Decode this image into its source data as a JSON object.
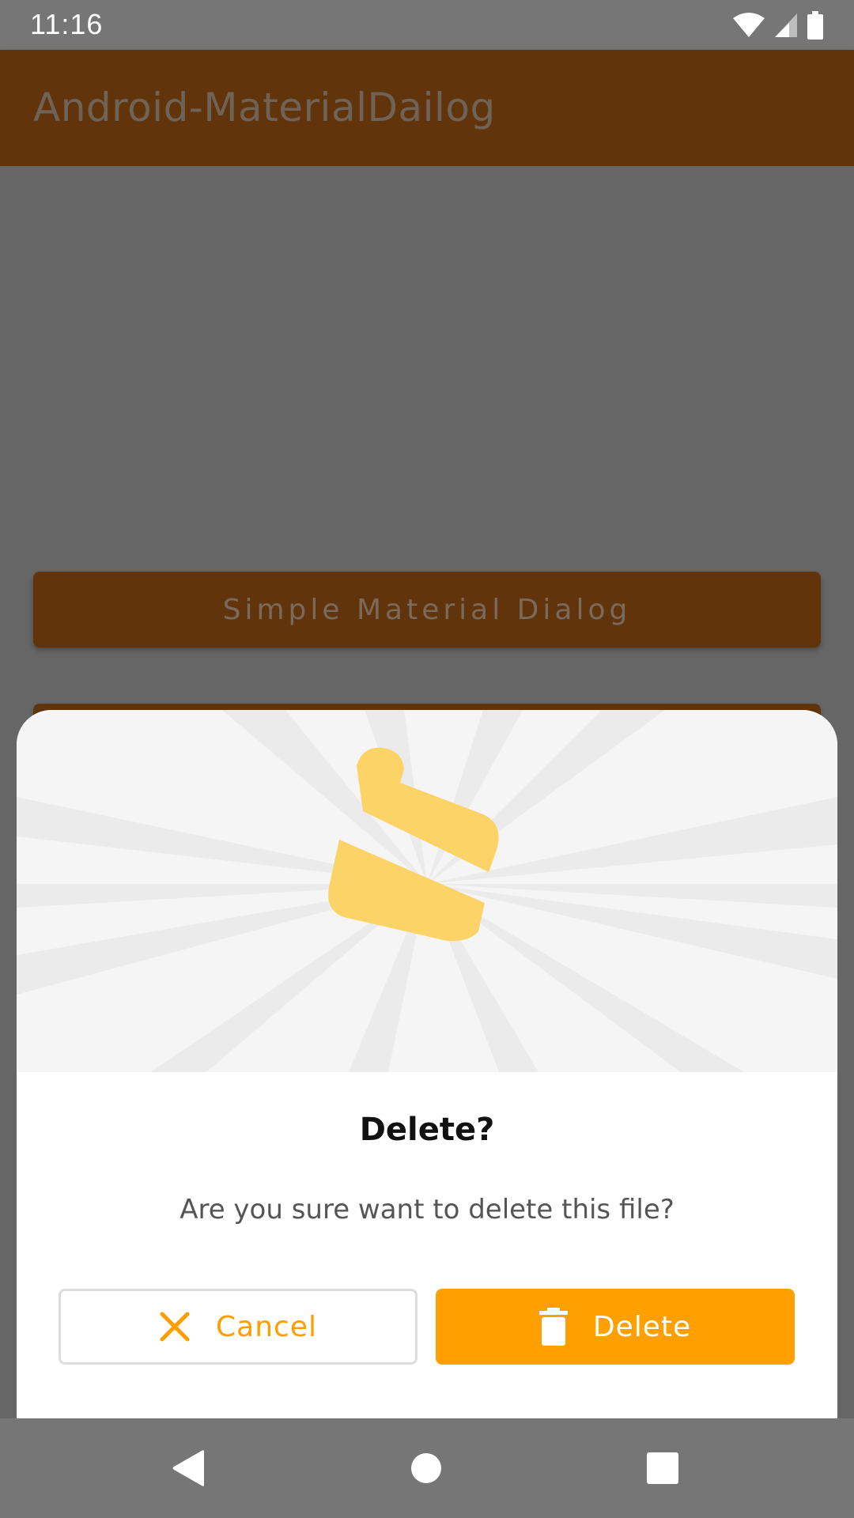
{
  "status_bar": {
    "time": "11:16"
  },
  "app_bar": {
    "title": "Android-MaterialDailog"
  },
  "content": {
    "buttons": [
      {
        "label": "Simple Material Dialog"
      },
      {
        "label": ""
      }
    ]
  },
  "dialog": {
    "title": "Delete?",
    "message": "Are you sure want to delete this file?",
    "cancel_label": "Cancel",
    "delete_label": "Delete",
    "accent_color": "#ffa000",
    "illustration_icon": "eraser-icon"
  },
  "nav_bar": {
    "back": "back-icon",
    "home": "home-icon",
    "recents": "recents-icon"
  }
}
